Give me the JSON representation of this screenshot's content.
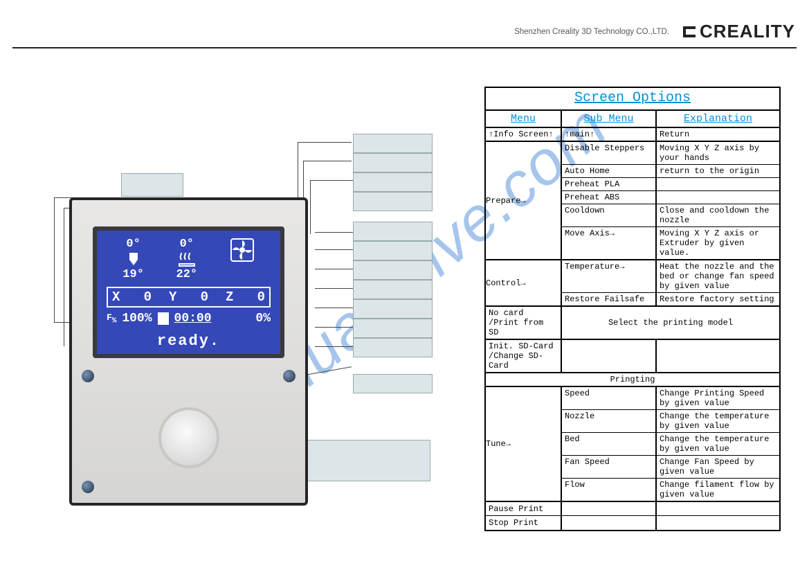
{
  "header": {
    "company_line": "Shenzhen Creality 3D Technology CO.,LTD.",
    "brand": "CREALITY"
  },
  "watermark": "manualshive.com",
  "lcd": {
    "nozzle_target": "0°",
    "nozzle_actual": "19°",
    "bed_target": "0°",
    "bed_actual": "22°",
    "x_label": "X",
    "x_val": "0",
    "y_label": "Y",
    "y_val": "0",
    "z_label": "Z",
    "z_val": "0",
    "feedrate_icon": "F%",
    "feedrate": "100%",
    "time": "00:00",
    "progress": "0%",
    "status": "ready."
  },
  "options": {
    "title": "Screen Options",
    "headers": {
      "menu": "Menu",
      "sub": "Sub Menu",
      "exp": "Explanation"
    },
    "info_row": {
      "menu": "↑Info Screen↑",
      "sub": "↑main↑",
      "exp": "Return"
    },
    "prepare": {
      "label": "Prepare→",
      "rows": [
        {
          "sub": "Disable Steppers",
          "exp": "Moving X Y Z axis by your hands"
        },
        {
          "sub": "Auto Home",
          "exp": "return to the origin"
        },
        {
          "sub": "Preheat PLA",
          "exp": ""
        },
        {
          "sub": "Preheat ABS",
          "exp": ""
        },
        {
          "sub": "Cooldown",
          "exp": "Close and cooldown the nozzle"
        },
        {
          "sub": "Move Axis→",
          "exp": "Moving X Y Z axis or Extruder by given value."
        }
      ]
    },
    "control": {
      "label": "Control→",
      "rows": [
        {
          "sub": "Temperature→",
          "exp": "Heat the nozzle and the bed or change fan speed by given value"
        },
        {
          "sub": "  Restore Failsafe",
          "exp": " Restore factory setting"
        }
      ]
    },
    "nocard": {
      "menu": "No card\n/Print from SD",
      "span": "Select the printing model"
    },
    "initsd": {
      "menu": "Init. SD-Card\n/Change SD-Card"
    },
    "printing_section": "Pringting",
    "tune": {
      "label": "Tune→",
      "rows": [
        {
          "sub": "Speed",
          "exp": "Change Printing Speed by given value"
        },
        {
          "sub": "Nozzle",
          "exp": "Change the temperature by given value"
        },
        {
          "sub": "Bed",
          "exp": "Change the temperature by given value"
        },
        {
          "sub": "Fan Speed",
          "exp": "Change Fan Speed by given value"
        },
        {
          "sub": "Flow",
          "exp": "Change filament flow by given value"
        }
      ]
    },
    "pause": "Pause Print",
    "stop": "Stop Print"
  }
}
